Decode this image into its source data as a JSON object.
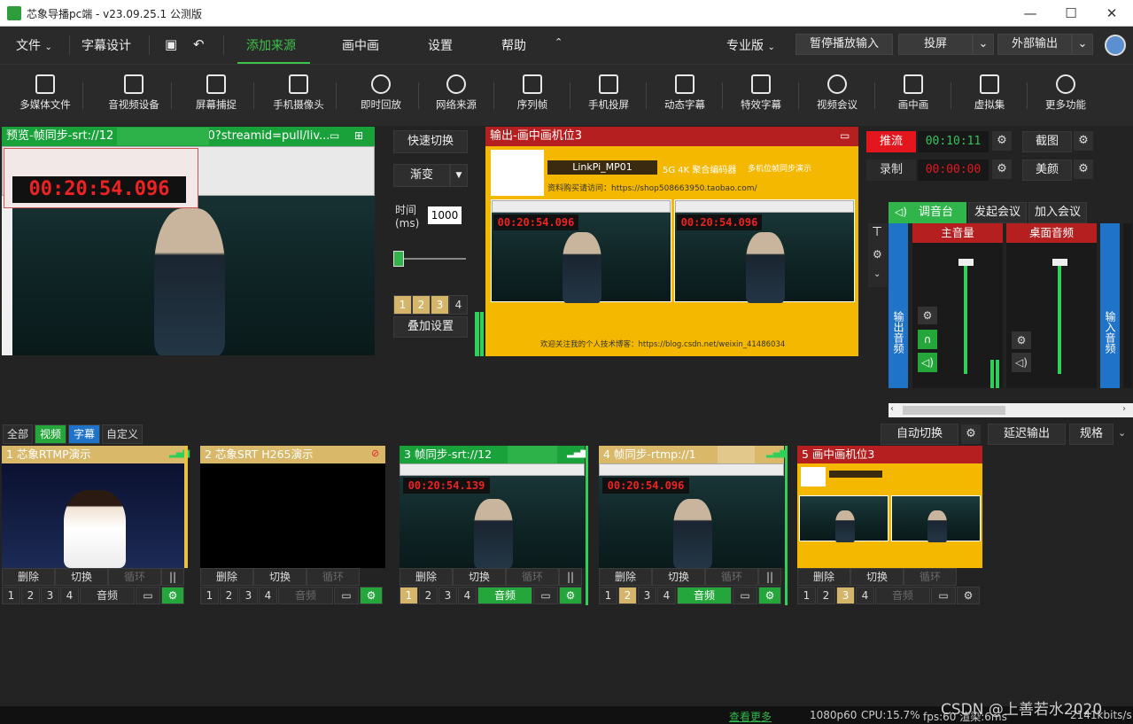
{
  "app": {
    "title": "芯象导播pc端 - v23.09.25.1 公测版"
  },
  "menu": {
    "file": "文件",
    "subtitle_design": "字幕设计",
    "add_source": "添加来源",
    "pip": "画中画",
    "settings": "设置",
    "help": "帮助",
    "edition": "专业版",
    "pause_input": "暂停播放输入",
    "cast": "投屏",
    "external_output": "外部输出"
  },
  "toolbar": [
    "多媒体文件",
    "音视频设备",
    "屏幕捕捉",
    "手机摄像头",
    "即时回放",
    "网络来源",
    "序列帧",
    "手机投屏",
    "动态字幕",
    "特效字幕",
    "视频会议",
    "画中画",
    "虚拟集",
    "更多功能"
  ],
  "preview": {
    "header": "预览-帧同步-srt://12",
    "header_tail": "80?streamid=pull/liv...",
    "timer": "00:20:54.096"
  },
  "transition": {
    "quick_switch": "快速切换",
    "fade": "渐变",
    "time_label": "时间",
    "time_unit": "(ms)",
    "time_value": "1000",
    "overlays": [
      "1",
      "2",
      "3",
      "4"
    ],
    "overlay_settings": "叠加设置"
  },
  "program": {
    "header": "输出-画中画机位3",
    "device": "LinkPi_MP01",
    "tagline": "5G 4K 聚合编码器",
    "tagline2": "多机位帧同步演示",
    "shop": "资料购买请访问：https://shop508663950.taobao.com/",
    "blog": "欢迎关注我的个人技术博客：https://blog.csdn.net/weixin_41486034",
    "timer": "00:20:54.096"
  },
  "stream": {
    "push_label": "推流",
    "push_time": "00:10:11",
    "record_label": "录制",
    "record_time": "00:00:00",
    "screenshot": "截图",
    "beauty": "美颜"
  },
  "audio": {
    "mixer_tab": "调音台",
    "start_meeting": "发起会议",
    "join_meeting": "加入会议",
    "master": "主音量",
    "desktop": "桌面音频",
    "output_audio": "输出音频",
    "input_audio": "输入音频"
  },
  "filters": {
    "all": "全部",
    "video": "视频",
    "subtitle": "字幕",
    "custom": "自定义"
  },
  "bottom_controls": {
    "auto_switch": "自动切换",
    "delay_output": "延迟输出",
    "spec": "规格"
  },
  "cards": [
    {
      "title": "1 芯象RTMP演示",
      "delete": "删除",
      "switch": "切换",
      "loop": "循环",
      "audio": "音频"
    },
    {
      "title": "2 芯象SRT H265演示",
      "delete": "删除",
      "switch": "切换",
      "loop": "循环",
      "audio": "音频"
    },
    {
      "title": "3 帧同步-srt://12",
      "title_tail": "0",
      "timer": "00:20:54.139",
      "delete": "删除",
      "switch": "切换",
      "loop": "循环",
      "audio": "音频"
    },
    {
      "title": "4 帧同步-rtmp://1",
      "timer": "00:20:54.096",
      "delete": "删除",
      "switch": "切换",
      "loop": "循环",
      "audio": "音频"
    },
    {
      "title": "5 画中画机位3",
      "delete": "删除",
      "switch": "切换",
      "loop": "循环",
      "audio": "音频"
    }
  ],
  "card_numbers": [
    "1",
    "2",
    "3",
    "4"
  ],
  "status": {
    "more": "查看更多",
    "res": "1080p60",
    "cpu": "CPU:15.7%",
    "fps": "fps:60 渲染:6ms",
    "bitrate": "2141kbits/s",
    "watermark": "CSDN @上善若水2020"
  },
  "colors": {
    "green": "#3ec24a",
    "preview_hdr": "#1aa23a",
    "program_hdr": "#b51f1f",
    "yellow": "#f5b800"
  }
}
